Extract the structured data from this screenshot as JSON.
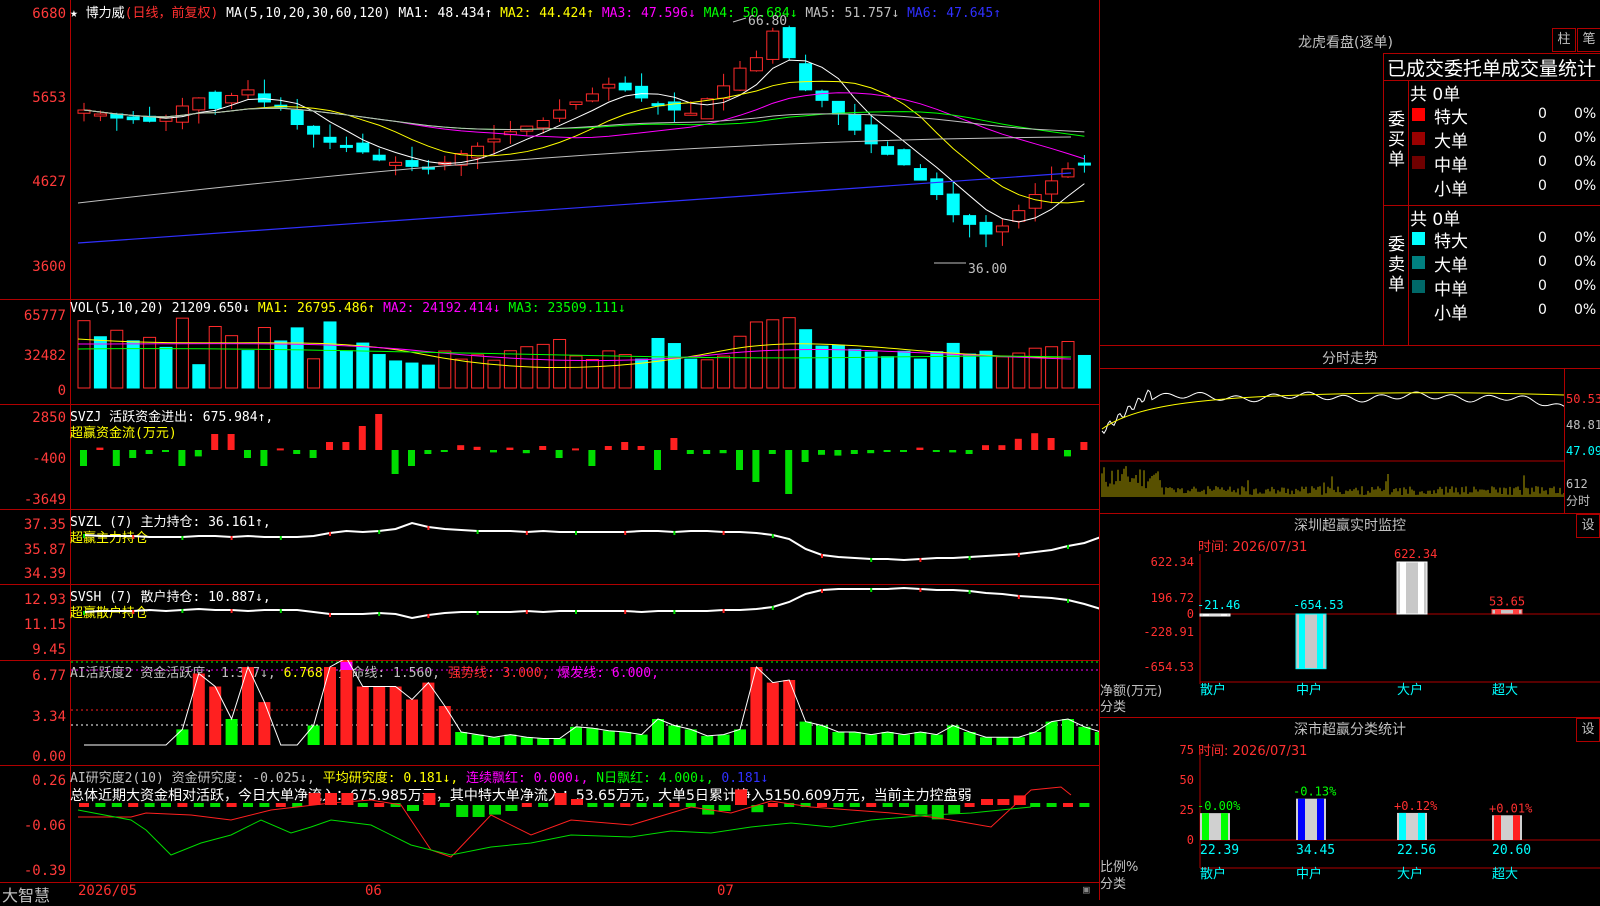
{
  "main": {
    "stock_name": "博力威",
    "chart_mode": "(日线，前复权)",
    "ma_params": "MA(5,10,20,30,60,120)",
    "ma_values": [
      {
        "label": "MA1: 48.434↑",
        "color": "#ffffff"
      },
      {
        "label": "MA2: 44.424↑",
        "color": "#ffff00"
      },
      {
        "label": "MA3: 47.596↓",
        "color": "#ff00ff"
      },
      {
        "label": "MA4: 50.684↓",
        "color": "#00ff00"
      },
      {
        "label": "MA5: 51.757↓",
        "color": "#c0c0c0"
      },
      {
        "label": "MA6: 47.645↑",
        "color": "#3030ff"
      }
    ],
    "y_ticks": [
      "6680",
      "5653",
      "4627",
      "3600"
    ],
    "high_mark": "66.80",
    "low_mark": "36.00"
  },
  "vol": {
    "header": "VOL(5,10,20)",
    "value": "21209.650↓",
    "ma": [
      {
        "label": "MA1: 26795.486↑",
        "color": "#ffff00"
      },
      {
        "label": "MA2: 24192.414↓",
        "color": "#ff00ff"
      },
      {
        "label": "MA3: 23509.111↓",
        "color": "#00ff00"
      }
    ],
    "y_ticks": [
      "65777",
      "32482",
      "0"
    ]
  },
  "svzj": {
    "header": "SVZJ  活跃资金进出: 675.984↑,",
    "sub": "超赢资金流(万元)",
    "y_ticks": [
      "2850",
      "-400",
      "-3649"
    ]
  },
  "svzl": {
    "header": "SVZL (7) 主力持仓: 36.161↑,",
    "sub": "超赢主力持仓",
    "y_ticks": [
      "37.35",
      "35.87",
      "34.39"
    ]
  },
  "svsh": {
    "header": "SVSH (7) 散户持仓: 10.887↓,",
    "sub": "超赢散户持仓",
    "y_ticks": [
      "12.93",
      "11.15",
      "9.45"
    ]
  },
  "ai_active": {
    "header_parts": [
      {
        "text": "AI活跃度2 资金活跃度: 1.337↓,",
        "color": "#c0c0c0"
      },
      {
        "text": "6.768,",
        "color": "#ffff00"
      },
      {
        "text": "生命线: 1.560,",
        "color": "#c0c0c0"
      },
      {
        "text": "强势线: 3.000,",
        "color": "#ff3030"
      },
      {
        "text": "爆发线: 6.000,",
        "color": "#ff00ff"
      }
    ],
    "y_ticks": [
      "6.77",
      "3.34",
      "0.00"
    ]
  },
  "ai_research": {
    "header_parts": [
      {
        "text": "AI研究度2(10) 资金研究度: -0.025↓,",
        "color": "#c0c0c0"
      },
      {
        "text": "平均研究度: 0.181↓,",
        "color": "#ffff00"
      },
      {
        "text": "连续飘红: 0.000↓,",
        "color": "#ff00ff"
      },
      {
        "text": "N日飘红: 4.000↓,",
        "color": "#00ff00"
      },
      {
        "text": "0.181↓",
        "color": "#3030ff"
      }
    ],
    "summary": "总体近期大资金相对活跃，今日大单净流入：675.985万元，其中特大单净流入：53.65万元，大单5日累计净入5150.609万元，当前主力控盘弱",
    "y_ticks": [
      "0.26",
      "-0.06",
      "-0.39"
    ]
  },
  "footer": {
    "brand": "大智慧",
    "dates": [
      "2026/05",
      "06",
      "07"
    ]
  },
  "lhkp": {
    "title": "龙虎看盘(逐单)",
    "btn1": "柱",
    "btn2": "笔",
    "section_title": "已成交委托单成交量统计",
    "buy": {
      "label": "委买单",
      "count": "共 0单",
      "rows": [
        {
          "name": "特大",
          "vol": "0",
          "pct": "0%",
          "color": "#ff0000"
        },
        {
          "name": "大单",
          "vol": "0",
          "pct": "0%",
          "color": "#9a0000"
        },
        {
          "name": "中单",
          "vol": "0",
          "pct": "0%",
          "color": "#700000"
        },
        {
          "name": "小单",
          "vol": "0",
          "pct": "0%",
          "color": "#000000"
        }
      ]
    },
    "sell": {
      "label": "委卖单",
      "count": "共 0单",
      "rows": [
        {
          "name": "特大",
          "vol": "0",
          "pct": "0%",
          "color": "#00ffff"
        },
        {
          "name": "大单",
          "vol": "0",
          "pct": "0%",
          "color": "#008080"
        },
        {
          "name": "中单",
          "vol": "0",
          "pct": "0%",
          "color": "#006868"
        },
        {
          "name": "小单",
          "vol": "0",
          "pct": "0%",
          "color": "#000000"
        }
      ]
    }
  },
  "intraday": {
    "title": "分时走势",
    "price_labels": [
      "50.53",
      "48.81",
      "47.09"
    ],
    "vol_label": "612",
    "vol_unit": "分时"
  },
  "monitor": {
    "title": "深圳超赢实时监控",
    "btn": "设",
    "time": "时间: 2026/07/31",
    "y_ticks": [
      "622.34",
      "196.72",
      "0",
      "-228.91",
      "-654.53"
    ],
    "axis_name": "净额(万元)",
    "axis_name2": "分类",
    "categories": [
      "散户",
      "中户",
      "大户",
      "超大"
    ],
    "values": [
      -21.46,
      -654.53,
      622.34,
      53.65
    ],
    "value_labels": [
      "-21.46",
      "-654.53",
      "622.34",
      "53.65"
    ]
  },
  "stats": {
    "title": "深市超赢分类统计",
    "btn": "设",
    "time": "时间: 2026/07/31",
    "y_ticks": [
      "75",
      "50",
      "25",
      "0"
    ],
    "axis_name": "比例%",
    "axis_name2": "分类",
    "categories": [
      "散户",
      "中户",
      "大户",
      "超大"
    ],
    "changes": [
      "-0.00%",
      "-0.13%",
      "+0.12%",
      "+0.01%"
    ],
    "values": [
      22.39,
      34.45,
      22.56,
      20.6
    ],
    "value_labels": [
      "22.39",
      "34.45",
      "22.56",
      "20.60"
    ]
  },
  "chart_data": [
    {
      "type": "bar",
      "title": "深圳超赢实时监控",
      "ylabel": "净额(万元)",
      "categories": [
        "散户",
        "中户",
        "大户",
        "超大"
      ],
      "values": [
        -21.46,
        -654.53,
        622.34,
        53.65
      ],
      "ylim": [
        -654.53,
        622.34
      ]
    },
    {
      "type": "bar",
      "title": "深市超赢分类统计",
      "ylabel": "比例%",
      "categories": [
        "散户",
        "中户",
        "大户",
        "超大"
      ],
      "values": [
        22.39,
        34.45,
        22.56,
        20.6
      ],
      "ylim": [
        0,
        75
      ]
    }
  ]
}
